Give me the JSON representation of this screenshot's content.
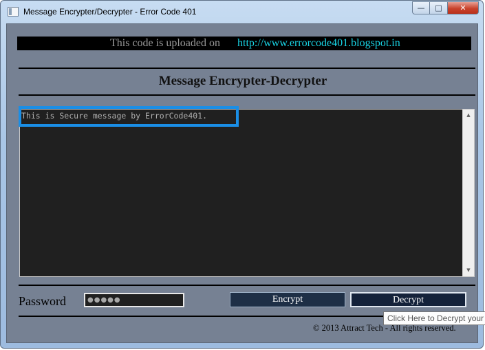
{
  "window": {
    "title": "Message Encrypter/Decrypter - Error Code 401"
  },
  "controls": {
    "minimize": "—",
    "maximize": "□",
    "close": "✕"
  },
  "banner": {
    "prefix": "This code is uploaded on",
    "link": "http://www.errorcode401.blogspot.in"
  },
  "heading": "Message Encrypter-Decrypter",
  "message": {
    "text": "This is Secure message by ErrorCode401."
  },
  "scrollbar": {
    "up": "▲",
    "down": "▼"
  },
  "password": {
    "label": "Password",
    "value": "●●●●●"
  },
  "buttons": {
    "encrypt": "Encrypt",
    "decrypt": "Decrypt"
  },
  "footer": "© 2013 Attract Tech - All rights reserved.",
  "tooltip": "Click Here to Decrypt your",
  "colors": {
    "banner_link": "#19d5e6",
    "highlight": "#1a8ee6",
    "close_button": "#c9432c"
  }
}
